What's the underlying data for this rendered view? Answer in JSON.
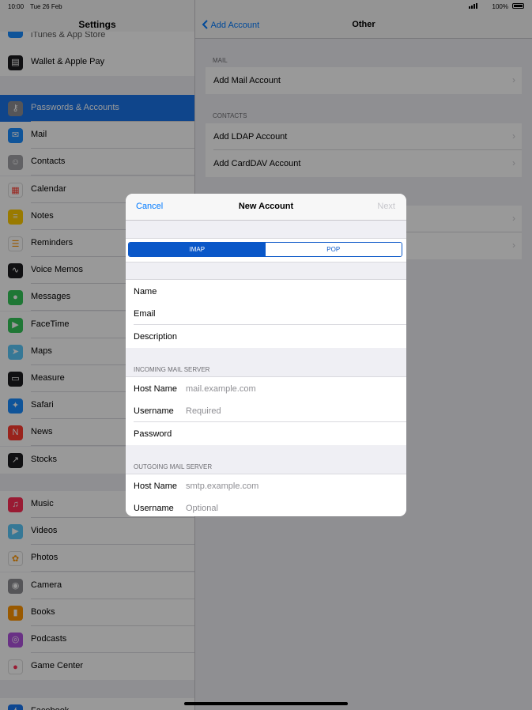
{
  "status_bar": {
    "time": "10:00",
    "date": "Tue 26 Feb",
    "battery": "100%"
  },
  "sidebar": {
    "title": "Settings",
    "partial_top_label": "iTunes & App Store",
    "groups": [
      [
        {
          "label": "Wallet & Apple Pay",
          "icon": "wallet-icon",
          "color": "#1c1c1e"
        }
      ],
      [
        {
          "label": "Passwords & Accounts",
          "icon": "key-icon",
          "color": "#8e8e93",
          "selected": true
        },
        {
          "label": "Mail",
          "icon": "mail-icon",
          "color": "#1a8cff"
        },
        {
          "label": "Contacts",
          "icon": "contacts-icon",
          "color": "#a2a2a7"
        },
        {
          "label": "Calendar",
          "icon": "calendar-icon",
          "color": "#ffffff"
        },
        {
          "label": "Notes",
          "icon": "notes-icon",
          "color": "#ffcc00"
        },
        {
          "label": "Reminders",
          "icon": "reminders-icon",
          "color": "#ffffff"
        },
        {
          "label": "Voice Memos",
          "icon": "voice-memos-icon",
          "color": "#1c1c1e"
        },
        {
          "label": "Messages",
          "icon": "messages-icon",
          "color": "#34c759"
        },
        {
          "label": "FaceTime",
          "icon": "facetime-icon",
          "color": "#34c759"
        },
        {
          "label": "Maps",
          "icon": "maps-icon",
          "color": "#5ac8fa"
        },
        {
          "label": "Measure",
          "icon": "measure-icon",
          "color": "#1c1c1e"
        },
        {
          "label": "Safari",
          "icon": "safari-icon",
          "color": "#1a8cff"
        },
        {
          "label": "News",
          "icon": "news-icon",
          "color": "#ff3b30"
        },
        {
          "label": "Stocks",
          "icon": "stocks-icon",
          "color": "#1c1c1e"
        }
      ],
      [
        {
          "label": "Music",
          "icon": "music-icon",
          "color": "#ff2d55"
        },
        {
          "label": "Videos",
          "icon": "videos-icon",
          "color": "#5ac8fa"
        },
        {
          "label": "Photos",
          "icon": "photos-icon",
          "color": "#ffffff"
        },
        {
          "label": "Camera",
          "icon": "camera-icon",
          "color": "#8e8e93"
        },
        {
          "label": "Books",
          "icon": "books-icon",
          "color": "#ff9500"
        },
        {
          "label": "Podcasts",
          "icon": "podcasts-icon",
          "color": "#af52de"
        },
        {
          "label": "Game Center",
          "icon": "game-center-icon",
          "color": "#ffffff"
        }
      ]
    ],
    "partial_bottom_label": "Facebook"
  },
  "right_pane": {
    "back_label": "Add Account",
    "title": "Other",
    "sections": [
      {
        "header": "MAIL",
        "rows": [
          "Add Mail Account"
        ]
      },
      {
        "header": "CONTACTS",
        "rows": [
          "Add LDAP Account",
          "Add CardDAV Account"
        ]
      }
    ]
  },
  "modal": {
    "cancel": "Cancel",
    "title": "New Account",
    "next": "Next",
    "segments": {
      "selected": "IMAP",
      "other": "POP"
    },
    "fields": [
      {
        "label": "Name",
        "value": ""
      },
      {
        "label": "Email",
        "value": ""
      },
      {
        "label": "Description",
        "value": ""
      }
    ],
    "incoming_header": "INCOMING MAIL SERVER",
    "incoming": [
      {
        "label": "Host Name",
        "placeholder": "mail.example.com"
      },
      {
        "label": "Username",
        "placeholder": "Required"
      },
      {
        "label": "Password",
        "placeholder": ""
      }
    ],
    "outgoing_header": "OUTGOING MAIL SERVER",
    "outgoing": [
      {
        "label": "Host Name",
        "placeholder": "smtp.example.com"
      },
      {
        "label": "Username",
        "placeholder": "Optional"
      }
    ]
  }
}
